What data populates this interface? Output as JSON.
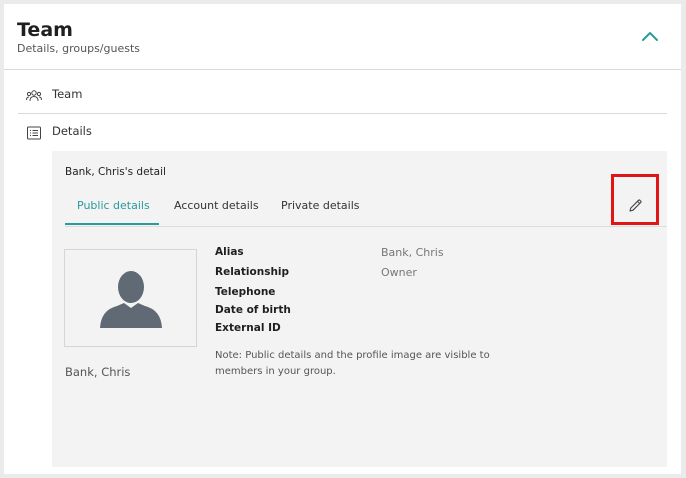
{
  "header": {
    "title": "Team",
    "subtitle": "Details, groups/guests"
  },
  "nav": {
    "team_label": "Team",
    "details_label": "Details"
  },
  "detail": {
    "title": "Bank, Chris's detail",
    "tabs": [
      {
        "label": "Public details",
        "active": true
      },
      {
        "label": "Account details",
        "active": false
      },
      {
        "label": "Private details",
        "active": false
      }
    ],
    "profile_name": "Bank, Chris",
    "fields": [
      {
        "label": "Alias",
        "value": "Bank, Chris"
      },
      {
        "label": "Relationship",
        "value": "Owner"
      },
      {
        "label": "Telephone",
        "value": ""
      },
      {
        "label": "Date of birth",
        "value": ""
      },
      {
        "label": "External ID",
        "value": ""
      }
    ],
    "note": "Note: Public details and the profile image are visible to members in your group."
  },
  "colors": {
    "accent": "#2a9a9a",
    "highlight": "#e01616",
    "avatar": "#5f6a74"
  },
  "icons": {
    "collapse": "chevron-up-icon",
    "team": "people-icon",
    "details": "list-icon",
    "edit": "pencil-icon",
    "avatar": "person-silhouette-icon"
  }
}
